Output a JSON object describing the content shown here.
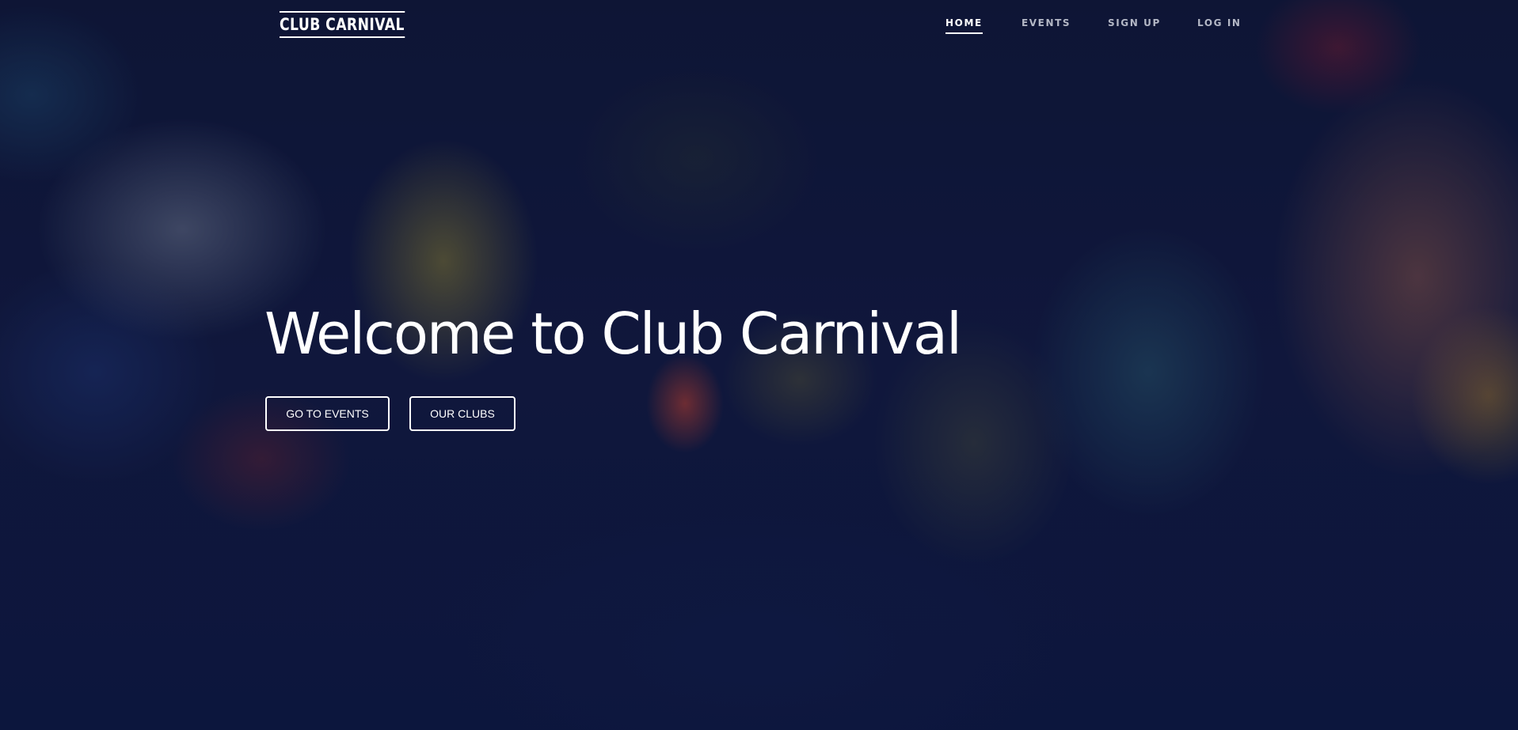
{
  "header": {
    "logo": "CLUB CARNIVAL",
    "nav": [
      {
        "label": "HOME",
        "active": true
      },
      {
        "label": "EVENTS",
        "active": false
      },
      {
        "label": "SIGN UP",
        "active": false
      },
      {
        "label": "LOG IN",
        "active": false
      }
    ]
  },
  "hero": {
    "title": "Welcome to Club Carnival",
    "buttons": [
      {
        "label": "GO TO EVENTS"
      },
      {
        "label": "OUR CLUBS"
      }
    ]
  },
  "colors": {
    "background": "#141b44",
    "text": "#ffffff",
    "nav_inactive": "#b4b8c6"
  }
}
